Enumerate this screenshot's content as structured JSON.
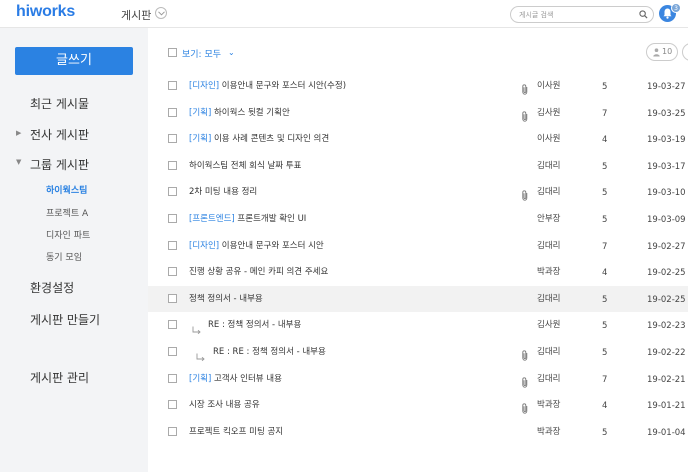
{
  "header": {
    "logo": "hiworks",
    "board_title": "게시판",
    "search_placeholder": "게시글 검색",
    "notification_count": "3"
  },
  "sidebar": {
    "write_button": "글쓰기",
    "items": [
      {
        "label": "최근 게시물"
      },
      {
        "label": "전사 게시판"
      },
      {
        "label": "그룹 게시판"
      },
      {
        "label": "환경설정"
      },
      {
        "label": "게시판 만들기"
      },
      {
        "label": "게시판 관리"
      }
    ],
    "sub_items": [
      {
        "label": "하이웍스팀",
        "active": true
      },
      {
        "label": "프로젝트 A"
      },
      {
        "label": "디자인 파트"
      },
      {
        "label": "동기 모임"
      }
    ]
  },
  "toolbar": {
    "view_label": "보기: 모두",
    "page_size": "10"
  },
  "posts": [
    {
      "tag": "[디자인]",
      "title": " 이용안내 문구와 포스터 시안(수정)",
      "attachment": true,
      "author": "이사원",
      "count": "5",
      "date": "19-03-27"
    },
    {
      "tag": "[기획]",
      "title": " 하이웍스 뒷컬 기획안",
      "attachment": true,
      "author": "김사원",
      "count": "7",
      "date": "19-03-25"
    },
    {
      "tag": "[기획]",
      "title": " 이용 사례 콘텐츠 및 디자인 의견",
      "attachment": false,
      "author": "이사원",
      "count": "4",
      "date": "19-03-19"
    },
    {
      "tag": "",
      "title": "하이웍스팀 전체 회식 날짜 투표",
      "attachment": false,
      "author": "김대리",
      "count": "5",
      "date": "19-03-17"
    },
    {
      "tag": "",
      "title": "2차 미팅 내용 정리",
      "attachment": true,
      "author": "김대리",
      "count": "5",
      "date": "19-03-10"
    },
    {
      "tag": "[프론트엔드]",
      "title": " 프론트개발 확인 UI",
      "attachment": false,
      "author": "안부장",
      "count": "5",
      "date": "19-03-09"
    },
    {
      "tag": "[디자인]",
      "title": " 이용안내 문구와 포스터 시안",
      "attachment": false,
      "author": "김대리",
      "count": "7",
      "date": "19-02-27"
    },
    {
      "tag": "",
      "title": "진행 상황 공유 - 메인 카피 의견 주세요",
      "attachment": false,
      "author": "박과장",
      "count": "4",
      "date": "19-02-25"
    },
    {
      "tag": "",
      "title": "정책 정의서 - 내부용",
      "attachment": false,
      "author": "김대리",
      "count": "5",
      "date": "19-02-25"
    },
    {
      "tag": "",
      "title": "RE : 정책 정의서 - 내부용",
      "attachment": false,
      "author": "김사원",
      "count": "5",
      "date": "19-02-23"
    },
    {
      "tag": "",
      "title": "RE : RE : 정책 정의서 - 내부용",
      "attachment": true,
      "author": "김대리",
      "count": "5",
      "date": "19-02-22"
    },
    {
      "tag": "[기획]",
      "title": " 고객사 인터뷰 내용",
      "attachment": true,
      "author": "김대리",
      "count": "7",
      "date": "19-02-21"
    },
    {
      "tag": "",
      "title": "시장 조사 내용 공유",
      "attachment": true,
      "author": "박과장",
      "count": "4",
      "date": "19-01-21"
    },
    {
      "tag": "",
      "title": "프로젝트 킥오프 미팅 공지",
      "attachment": false,
      "author": "박과장",
      "count": "5",
      "date": "19-01-04"
    }
  ]
}
